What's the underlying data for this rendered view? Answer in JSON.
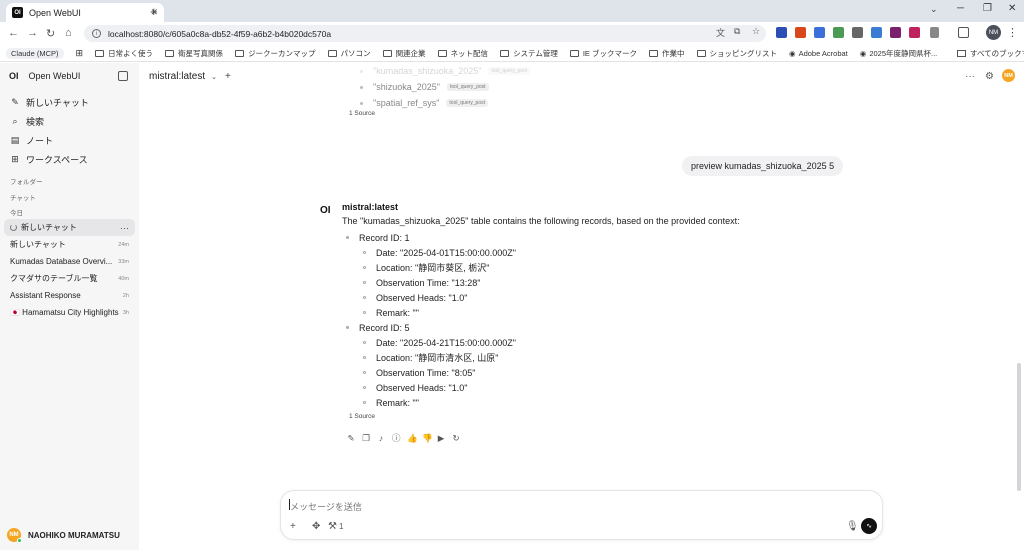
{
  "browser": {
    "tab_title": "Open WebUI",
    "tab_favicon": "OI",
    "url": "localhost:8080/c/605a0c8a-db52-4f59-a6b2-b4b020dc570a",
    "profile_initials": "NM",
    "bookmarks": [
      "Claude (MCP)",
      "日常よく使う",
      "衛星写真関係",
      "ジークーカンマップ",
      "パソコン",
      "関連企業",
      "ネット配信",
      "システム管理",
      "IE ブックマーク",
      "作業中",
      "ショッピングリスト",
      "Adobe Acrobat",
      "2025年度静岡県杯..."
    ],
    "bookmarks_right": "すべてのブックマーク"
  },
  "sidebar": {
    "logo": "OI",
    "app_name": "Open WebUI",
    "nav": [
      {
        "icon": "edit-icon",
        "label": "新しいチャット"
      },
      {
        "icon": "search-icon",
        "label": "検索"
      },
      {
        "icon": "notes-icon",
        "label": "ノート"
      },
      {
        "icon": "workspace-icon",
        "label": "ワークスペース"
      }
    ],
    "folders_label": "フォルダー",
    "chats_label": "チャット",
    "today_label": "今日",
    "chats": [
      {
        "title": "新しいチャット",
        "time": "",
        "active": true
      },
      {
        "title": "新しいチャット",
        "time": "24m"
      },
      {
        "title": "Kumadas Database Overvi...",
        "time": "33m"
      },
      {
        "title": "クマダサのテーブル一覧",
        "time": "40m"
      },
      {
        "title": "Assistant Response",
        "time": "2h"
      },
      {
        "title": "🇯🇵 Hamamatsu City Highlights",
        "time": "3h"
      }
    ],
    "user": {
      "initials": "NM",
      "name": "NAOHIKO MURAMATSU"
    }
  },
  "main": {
    "model": "mistral:latest",
    "top_avatar": "NM",
    "faded_items": [
      {
        "name": "\"kumadas_shizuoka_2025\"",
        "tag": "tool_query_post",
        "faded": true
      },
      {
        "name": "\"shizuoka_2025\"",
        "tag": "tool_query_post",
        "faded": false
      },
      {
        "name": "\"spatial_ref_sys\"",
        "tag": "tool_query_post",
        "faded": false
      }
    ],
    "source_label_1": "1 Source",
    "user_message": "preview kumadas_shizuoka_2025 5",
    "assistant": {
      "logo": "OI",
      "name": "mistral:latest",
      "intro": "The \"kumadas_shizuoka_2025\" table contains the following records, based on the provided context:",
      "records": [
        {
          "id": "Record ID: 1",
          "fields": [
            "Date: \"2025-04-01T15:00:00.000Z\"",
            "Location: \"静岡市葵区, 栃沢\"",
            "Observation Time: \"13:28\"",
            "Observed Heads: \"1.0\"",
            "Remark: \"\""
          ]
        },
        {
          "id": "Record ID: 5",
          "fields": [
            "Date: \"2025-04-21T15:00:00.000Z\"",
            "Location: \"静岡市清水区, 山原\"",
            "Observation Time: \"8:05\"",
            "Observed Heads: \"1.0\"",
            "Remark: \"\""
          ]
        }
      ]
    },
    "source_label_2": "1 Source",
    "composer": {
      "placeholder": "メッセージを送信",
      "tool_count": "1"
    }
  }
}
